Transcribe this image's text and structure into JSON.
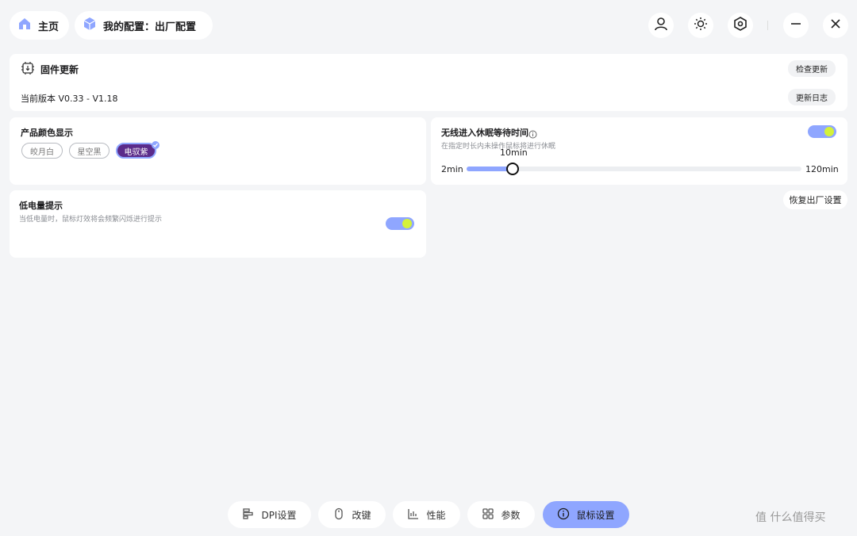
{
  "header": {
    "home_label": "主页",
    "config_label": "我的配置：出厂配置",
    "icons": [
      "user-icon",
      "brightness-icon",
      "settings-hex-icon",
      "minimize-icon",
      "close-icon"
    ]
  },
  "firmware": {
    "title": "固件更新",
    "check_update": "检查更新",
    "version_text": "当前版本 V0.33 - V1.18",
    "changelog": "更新日志"
  },
  "color_display": {
    "title": "产品颜色显示",
    "options": [
      "皎月白",
      "星空黑",
      "电驭紫"
    ],
    "selected": "电驭紫"
  },
  "sleep": {
    "title": "无线进入休眠等待时间",
    "description": "在指定时长内未操作鼠标将进行休眠",
    "enabled": true,
    "min_label": "2min",
    "max_label": "120min",
    "value_label": "10min",
    "value": 10,
    "min": 2,
    "max": 120
  },
  "low_battery": {
    "title": "低电量提示",
    "description": "当低电量时，鼠标灯效将会频繁闪烁进行提示",
    "enabled": true
  },
  "reset_button": "恢复出厂设置",
  "bottom_tabs": [
    {
      "label": "DPI设置",
      "active": false
    },
    {
      "label": "改键",
      "active": false
    },
    {
      "label": "性能",
      "active": false
    },
    {
      "label": "参数",
      "active": false
    },
    {
      "label": "鼠标设置",
      "active": true
    }
  ],
  "watermark": "值 什么值得买",
  "colors": {
    "accent": "#8fa6ff",
    "toggle_knob": "#d4f13a",
    "purple": "#5b2b8a",
    "background": "#f4f5f7"
  }
}
